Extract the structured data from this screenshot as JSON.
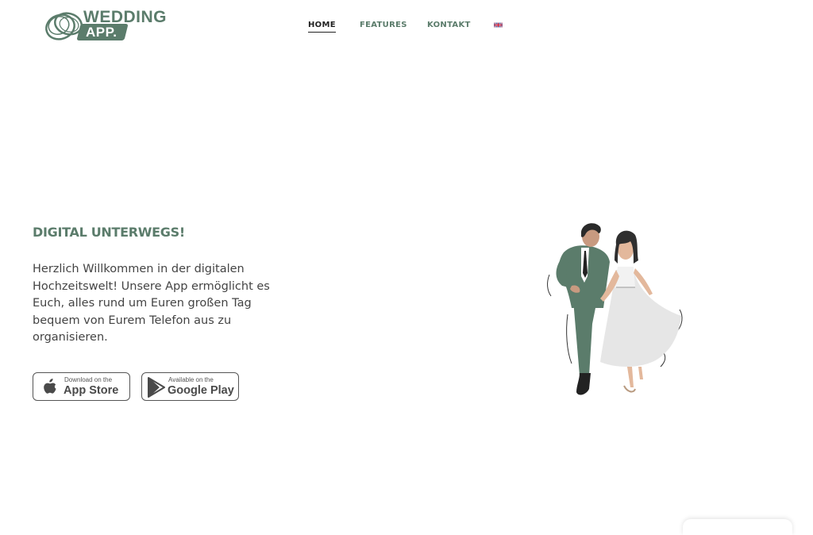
{
  "header": {
    "logo": {
      "word1": "WEDDING",
      "word2": "APP."
    },
    "nav": [
      {
        "label": "HOME",
        "active": true
      },
      {
        "label": "FEATURES",
        "active": false
      },
      {
        "label": "KONTAKT",
        "active": false
      }
    ],
    "language_icon": "uk-flag-icon"
  },
  "hero": {
    "title": "DIGITAL UNTERWEGS!",
    "text": "Herzlich Willkommen in der digitalen Hochzeitswelt! Unsere App ermöglicht es Euch, alles rund um Euren großen Tag bequem von Eurem Telefon aus zu organisieren.",
    "app_store": {
      "small": "Download on the",
      "big": "App Store",
      "icon": "apple-icon"
    },
    "google_play": {
      "small": "Available on the",
      "big": "Google Play",
      "icon": "play-triangle-icon"
    },
    "illustration": "wedding-couple-illustration"
  },
  "colors": {
    "accent": "#5b7c6b",
    "text": "#444444",
    "background": "#ffffff"
  }
}
